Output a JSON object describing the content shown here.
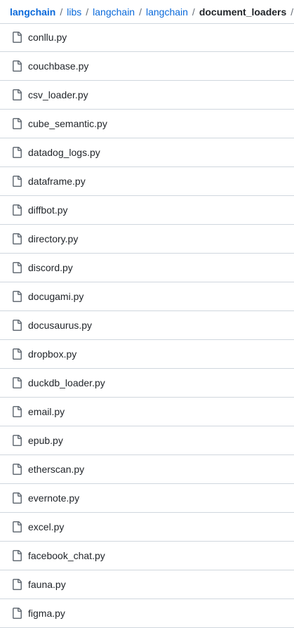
{
  "breadcrumb": {
    "items": [
      "langchain",
      "libs",
      "langchain",
      "langchain"
    ],
    "separator": "/",
    "current": "document_loaders",
    "trailing_separator": "/"
  },
  "files": [
    {
      "name": "conllu.py",
      "icon": "file-icon"
    },
    {
      "name": "couchbase.py",
      "icon": "file-icon"
    },
    {
      "name": "csv_loader.py",
      "icon": "file-icon"
    },
    {
      "name": "cube_semantic.py",
      "icon": "file-icon"
    },
    {
      "name": "datadog_logs.py",
      "icon": "file-icon"
    },
    {
      "name": "dataframe.py",
      "icon": "file-icon"
    },
    {
      "name": "diffbot.py",
      "icon": "file-icon"
    },
    {
      "name": "directory.py",
      "icon": "file-icon"
    },
    {
      "name": "discord.py",
      "icon": "file-icon"
    },
    {
      "name": "docugami.py",
      "icon": "file-icon"
    },
    {
      "name": "docusaurus.py",
      "icon": "file-icon"
    },
    {
      "name": "dropbox.py",
      "icon": "file-icon"
    },
    {
      "name": "duckdb_loader.py",
      "icon": "file-icon"
    },
    {
      "name": "email.py",
      "icon": "file-icon"
    },
    {
      "name": "epub.py",
      "icon": "file-icon"
    },
    {
      "name": "etherscan.py",
      "icon": "file-icon"
    },
    {
      "name": "evernote.py",
      "icon": "file-icon"
    },
    {
      "name": "excel.py",
      "icon": "file-icon"
    },
    {
      "name": "facebook_chat.py",
      "icon": "file-icon"
    },
    {
      "name": "fauna.py",
      "icon": "file-icon"
    },
    {
      "name": "figma.py",
      "icon": "file-icon"
    }
  ],
  "colors": {
    "link": "#0969da",
    "text": "#1f2328",
    "muted": "#656d76",
    "border": "#d0d7de"
  }
}
